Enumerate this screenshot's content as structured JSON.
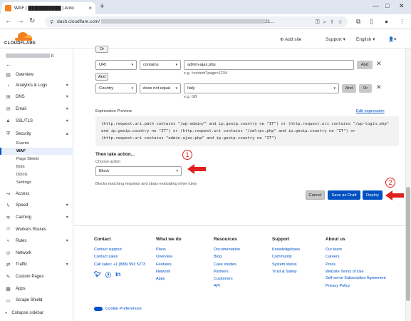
{
  "browser": {
    "tab_title": "WAF | ██████████ | Anto",
    "tab_close": "×",
    "new_tab": "+",
    "url_prefix": "dash.cloudflare.com/",
    "url_suffix": "21..."
  },
  "header": {
    "logo_text": "CLOUDFLARE",
    "add_site": "Add site",
    "support": "Support",
    "language": "English"
  },
  "sidebar": {
    "account_suffix": "it",
    "items": [
      {
        "label": "Overview"
      },
      {
        "label": "Analytics & Logs"
      },
      {
        "label": "DNS"
      },
      {
        "label": "Email"
      },
      {
        "label": "SSL/TLS"
      },
      {
        "label": "Security"
      },
      {
        "label": "Access"
      },
      {
        "label": "Speed"
      },
      {
        "label": "Caching"
      },
      {
        "label": "Workers Routes"
      },
      {
        "label": "Rules"
      },
      {
        "label": "Network"
      },
      {
        "label": "Traffic"
      },
      {
        "label": "Custom Pages"
      },
      {
        "label": "Apps"
      },
      {
        "label": "Scrape Shield"
      }
    ],
    "security_sub": [
      "Events",
      "WAF",
      "Page Shield",
      "Bots",
      "DDoS",
      "Settings"
    ],
    "collapse": "Collapse sidebar"
  },
  "rule": {
    "or_top": "Or",
    "row1": {
      "field": "URI",
      "operator": "contains",
      "value": "admin-ajax.php",
      "hint": "e.g. /content?page=1234",
      "and_btn": "And"
    },
    "and_between": "And",
    "row2": {
      "field": "Country",
      "operator": "does not equal",
      "value": "Italy",
      "hint": "e.g. GB",
      "and_btn": "And",
      "or_btn": "Or"
    },
    "expression_label": "Expression Preview",
    "edit_expression": "Edit expression",
    "expression": "(http.request.uri.path contains \"/wp-admin/\" and ip.geoip.country ne \"IT\") or (http.request.uri contains \"/wp-login.php\" and ip.geoip.country ne \"IT\") or (http.request.uri contains \"/xmlrpc.php\" and ip.geoip.country ne \"IT\") or (http.request.uri contains \"admin-ajax.php\" and ip.geoip.country ne \"IT\")",
    "then_take_action": "Then take action...",
    "choose_action": "Choose action",
    "action_value": "Block",
    "action_hint": "Blocks matching requests and stops evaluating other rules",
    "cancel": "Cancel",
    "save_draft": "Save as Draft",
    "deploy": "Deploy"
  },
  "annotations": {
    "one": "1",
    "two": "2"
  },
  "footer": {
    "contact": {
      "title": "Contact",
      "links": [
        "Contact support",
        "Contact sales",
        "Call sales: +1 (888) 993 5273"
      ]
    },
    "what_we_do": {
      "title": "What we do",
      "links": [
        "Plans",
        "Overview",
        "Features",
        "Network",
        "Apps"
      ]
    },
    "resources": {
      "title": "Resources",
      "links": [
        "Documentation",
        "Blog",
        "Case studies",
        "Partners",
        "Customers",
        "API"
      ]
    },
    "support": {
      "title": "Support",
      "links": [
        "Knowledgebase",
        "Community",
        "System status",
        "Trust & Safety"
      ]
    },
    "about": {
      "title": "About us",
      "links": [
        "Our team",
        "Careers",
        "Press",
        "Website Terms of Use",
        "Self-serve Subscription Agreement",
        "Privacy Policy"
      ]
    },
    "cookie": "Cookie Preferences"
  }
}
